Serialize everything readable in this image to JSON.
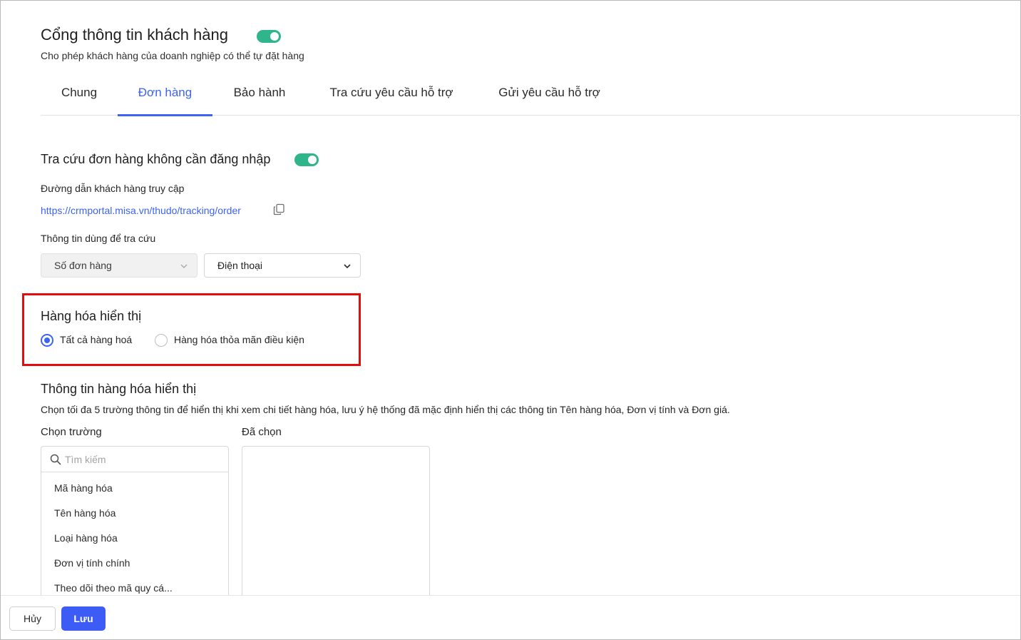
{
  "header": {
    "title": "Cổng thông tin khách hàng",
    "subtitle": "Cho phép khách hàng của doanh nghiệp có thể tự đặt hàng",
    "portal_enabled": true
  },
  "tabs": [
    {
      "label": "Chung",
      "active": false
    },
    {
      "label": "Đơn hàng",
      "active": true
    },
    {
      "label": "Bảo hành",
      "active": false
    },
    {
      "label": "Tra cứu yêu cầu hỗ trợ",
      "active": false
    },
    {
      "label": "Gửi yêu cầu hỗ trợ",
      "active": false
    }
  ],
  "lookup": {
    "title": "Tra cứu đơn hàng không cần đăng nhập",
    "enabled": true,
    "url_label": "Đường dẫn khách hàng truy cập",
    "url": "https://crmportal.misa.vn/thudo/tracking/order",
    "info_label": "Thông tin dùng để tra cứu",
    "select_primary": "Số đơn hàng",
    "select_secondary": "Điện thoại"
  },
  "display_goods": {
    "title": "Hàng hóa hiển thị",
    "options": [
      {
        "label": "Tất cả hàng hoá",
        "checked": true
      },
      {
        "label": "Hàng hóa thỏa mãn điều kiện",
        "checked": false
      }
    ]
  },
  "goods_info": {
    "title": "Thông tin hàng hóa hiển thị",
    "description": "Chọn tối đa 5 trường thông tin để hiển thị khi xem chi tiết hàng hóa, lưu ý hệ thống đã mặc định hiển thị các thông tin Tên hàng hóa, Đơn vị tính và Đơn giá.",
    "choose_label": "Chọn trường",
    "selected_label": "Đã chọn",
    "search_placeholder": "Tìm kiếm",
    "fields": [
      "Mã hàng hóa",
      "Tên hàng hóa",
      "Loại hàng hóa",
      "Đơn vị tính chính",
      "Theo dõi theo mã quy cá..."
    ]
  },
  "footer": {
    "cancel_label": "Hủy",
    "save_label": "Lưu"
  },
  "colors": {
    "accent": "#3d63f5",
    "toggle_on": "#2fb58c",
    "highlight": "#e50c0c"
  }
}
